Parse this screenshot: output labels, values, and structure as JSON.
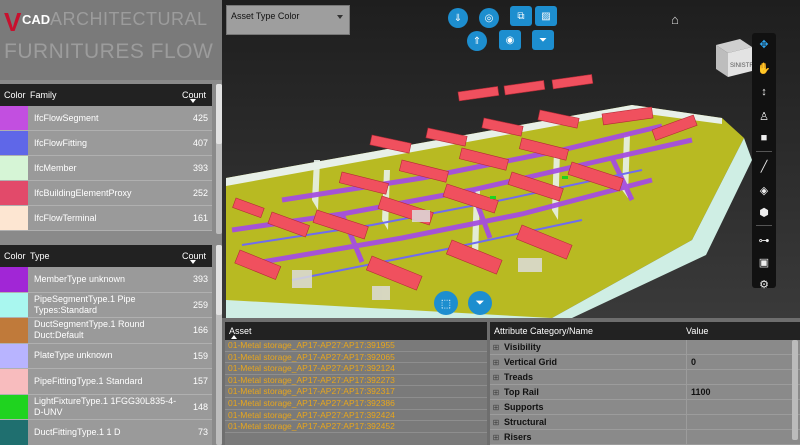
{
  "logo": {
    "v": "V",
    "cad": "CAD",
    "line1": "ARCHITECTURAL",
    "line2": "FURNITURES FLOW"
  },
  "family_table": {
    "headers": {
      "color": "Color",
      "name": "Family",
      "count": "Count"
    },
    "rows": [
      {
        "color": "#c24fe0",
        "name": "IfcFlowSegment",
        "count": "425"
      },
      {
        "color": "#5f67e8",
        "name": "IfcFlowFitting",
        "count": "407"
      },
      {
        "color": "#d6f5d6",
        "name": "IfcMember",
        "count": "393"
      },
      {
        "color": "#e24a6a",
        "name": "IfcBuildingElementProxy",
        "count": "252"
      },
      {
        "color": "#fde6d2",
        "name": "IfcFlowTerminal",
        "count": "161"
      }
    ]
  },
  "type_table": {
    "headers": {
      "color": "Color",
      "name": "Type",
      "count": "Count"
    },
    "rows": [
      {
        "color": "#a126d6",
        "name": "MemberType unknown",
        "count": "393"
      },
      {
        "color": "#a9f7ef",
        "name": "PipeSegmentType.1 Pipe Types:Standard",
        "count": "259"
      },
      {
        "color": "#c07a3a",
        "name": "DuctSegmentType.1 Round Duct:Default",
        "count": "166"
      },
      {
        "color": "#b8b4ff",
        "name": "PlateType unknown",
        "count": "159"
      },
      {
        "color": "#f8bcbe",
        "name": "PipeFittingType.1 Standard",
        "count": "157"
      },
      {
        "color": "#1fd31f",
        "name": "LightFixtureType.1 1FGG30L835-4-D-UNV",
        "count": "148"
      },
      {
        "color": "#1f6f6f",
        "name": "DuctFittingType.1 1 D",
        "count": "73"
      }
    ]
  },
  "viewport": {
    "selector_value": "Asset Type Color",
    "cube_label": "SINISTRA",
    "top_buttons": [
      "download-icon",
      "target-icon",
      "copy-icon",
      "hatch-icon",
      "upload-icon",
      "radio-icon",
      "filter-icon"
    ],
    "right_tools": [
      "orbit-icon",
      "pan-icon",
      "zoom-icon",
      "walk-icon",
      "camera-icon",
      "measure-icon",
      "section-icon",
      "explode-icon",
      "tree-icon",
      "properties-icon",
      "settings-icon"
    ]
  },
  "assets": {
    "header": "Asset",
    "items": [
      "01-Metal storage_AP17-AP27:AP17:391955",
      "01-Metal storage_AP17-AP27:AP17:392065",
      "01-Metal storage_AP17-AP27:AP17:392124",
      "01-Metal storage_AP17-AP27:AP17:392273",
      "01-Metal storage_AP17-AP27:AP17:392317",
      "01-Metal storage_AP17-AP27:AP17:392386",
      "01-Metal storage_AP17-AP27:AP17:392424",
      "01-Metal storage_AP17-AP27:AP17:392452"
    ]
  },
  "attributes": {
    "headers": {
      "name": "Attribute Category/Name",
      "value": "Value"
    },
    "rows": [
      {
        "name": "Visibility",
        "value": ""
      },
      {
        "name": "Vertical Grid",
        "value": "0"
      },
      {
        "name": "Treads",
        "value": ""
      },
      {
        "name": "Top Rail",
        "value": "1100"
      },
      {
        "name": "Supports",
        "value": ""
      },
      {
        "name": "Structural",
        "value": ""
      },
      {
        "name": "Risers",
        "value": ""
      }
    ]
  }
}
